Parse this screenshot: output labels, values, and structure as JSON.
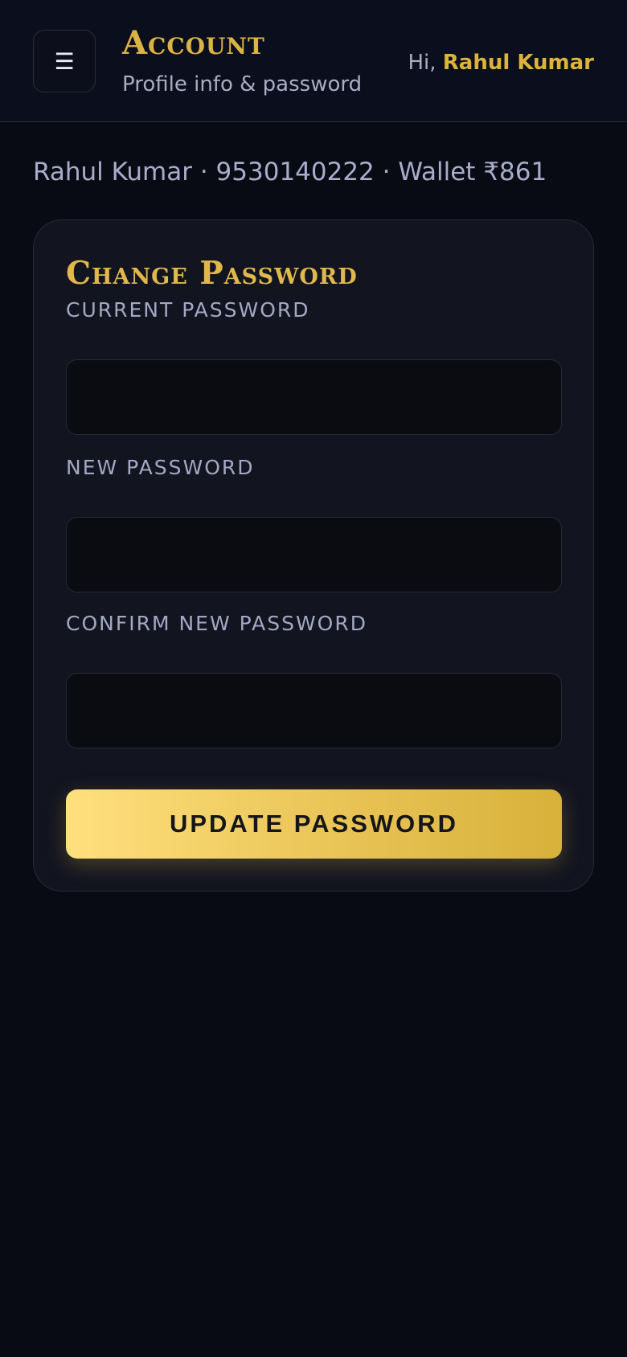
{
  "header": {
    "menu_icon_glyph": "☰",
    "title": "Account",
    "subtitle": "Profile info & password",
    "greeting_prefix": "Hi,",
    "user_name": "Rahul Kumar"
  },
  "account_info": {
    "summary": "Rahul Kumar · 9530140222 · Wallet ₹861"
  },
  "change_password_form": {
    "title": "Change Password",
    "fields": [
      {
        "label": "Current Password",
        "value": ""
      },
      {
        "label": "New Password",
        "value": ""
      },
      {
        "label": "Confirm New Password",
        "value": ""
      }
    ],
    "submit_label": "Update Password"
  },
  "colors": {
    "background": "#090b14",
    "accent_gold": "#d9b444",
    "muted_text": "#a9adc2"
  }
}
